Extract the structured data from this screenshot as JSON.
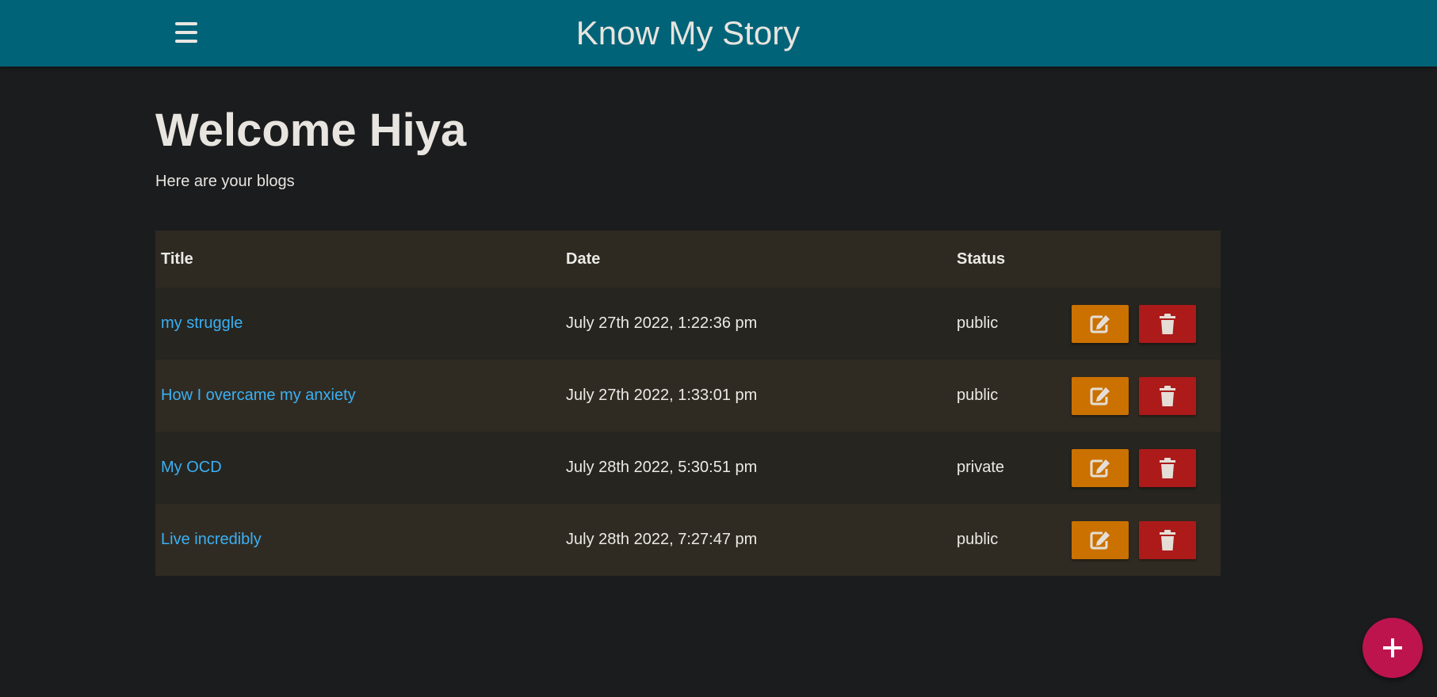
{
  "header": {
    "app_title": "Know My Story",
    "menu_icon": "hamburger-menu-icon"
  },
  "main": {
    "welcome": "Welcome Hiya",
    "subtitle": "Here are your blogs"
  },
  "table": {
    "columns": [
      "Title",
      "Date",
      "Status",
      ""
    ],
    "rows": [
      {
        "title": "my struggle",
        "date": "July 27th 2022, 1:22:36 pm",
        "status": "public"
      },
      {
        "title": "How I overcame my anxiety",
        "date": "July 27th 2022, 1:33:01 pm",
        "status": "public"
      },
      {
        "title": "My OCD",
        "date": "July 28th 2022, 5:30:51 pm",
        "status": "private"
      },
      {
        "title": "Live incredibly",
        "date": "July 28th 2022, 7:27:47 pm",
        "status": "public"
      }
    ],
    "edit_icon": "edit-icon",
    "delete_icon": "trash-icon"
  },
  "fab": {
    "icon": "plus-icon"
  },
  "colors": {
    "header_bg": "#006378",
    "page_bg": "#1b1c1e",
    "link": "#3ab0f5",
    "edit_button": "#cb7100",
    "delete_button": "#ad1a1a",
    "fab": "#bd144e"
  }
}
